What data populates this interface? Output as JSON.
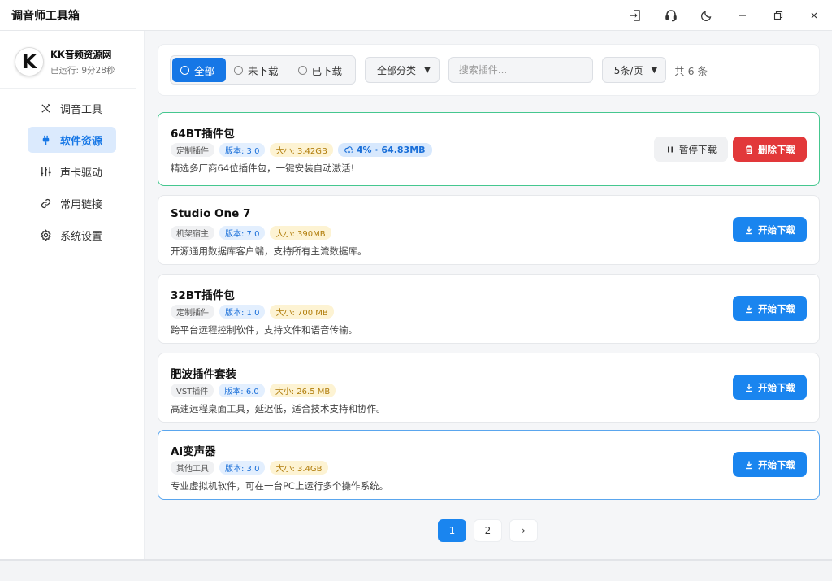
{
  "app": {
    "title": "调音师工具箱"
  },
  "titlebar_icons": [
    "logout-icon",
    "headset-icon",
    "moon-icon",
    "minimize-icon",
    "restore-icon",
    "close-icon"
  ],
  "profile": {
    "name": "KK音频资源网",
    "logo_letter": "K",
    "uptime": "已运行: 9分28秒"
  },
  "sidebar": {
    "items": [
      {
        "label": "调音工具",
        "icon": "tools-icon",
        "active": false
      },
      {
        "label": "软件资源",
        "icon": "plug-icon",
        "active": true
      },
      {
        "label": "声卡驱动",
        "icon": "sliders-icon",
        "active": false
      },
      {
        "label": "常用链接",
        "icon": "link-icon",
        "active": false
      },
      {
        "label": "系统设置",
        "icon": "gear-icon",
        "active": false
      }
    ]
  },
  "filter": {
    "segments": [
      "全部",
      "未下载",
      "已下载"
    ],
    "selected_segment": "全部",
    "category": "全部分类",
    "search_placeholder": "搜索插件...",
    "page_size": "5条/页",
    "total": "共 6 条"
  },
  "items": [
    {
      "name": "64BT插件包",
      "category": "定制插件",
      "version": "版本: 3.0",
      "size": "大小: 3.42GB",
      "progress_label": "4% · 64.83MB",
      "progress_percent": 4,
      "desc": "精选多厂商64位插件包，一键安装自动激活!",
      "pause_label": "暂停下载",
      "delete_label": "删除下载"
    },
    {
      "name": "Studio One 7",
      "category": "机架宿主",
      "version": "版本: 7.0",
      "size": "大小: 390MB",
      "desc": "开源通用数据库客户端，支持所有主流数据库。",
      "action_label": "开始下载"
    },
    {
      "name": "32BT插件包",
      "category": "定制插件",
      "version": "版本: 1.0",
      "size": "大小: 700 MB",
      "desc": "跨平台远程控制软件，支持文件和语音传输。",
      "action_label": "开始下载"
    },
    {
      "name": "肥波插件套装",
      "category": "VST插件",
      "version": "版本: 6.0",
      "size": "大小: 26.5 MB",
      "desc": "高速远程桌面工具，延迟低，适合技术支持和协作。",
      "action_label": "开始下载"
    },
    {
      "name": "Ai变声器",
      "category": "其他工具",
      "version": "版本: 3.0",
      "size": "大小: 3.4GB",
      "desc": "专业虚拟机软件，可在一台PC上运行多个操作系统。",
      "action_label": "开始下载"
    }
  ],
  "pagination": {
    "pages": [
      "1",
      "2"
    ],
    "current": "1",
    "next": "›"
  },
  "colors": {
    "primary": "#1a85ef",
    "danger": "#e2383a",
    "active_border": "#45c78f",
    "hover_border": "#5aa6ee"
  }
}
